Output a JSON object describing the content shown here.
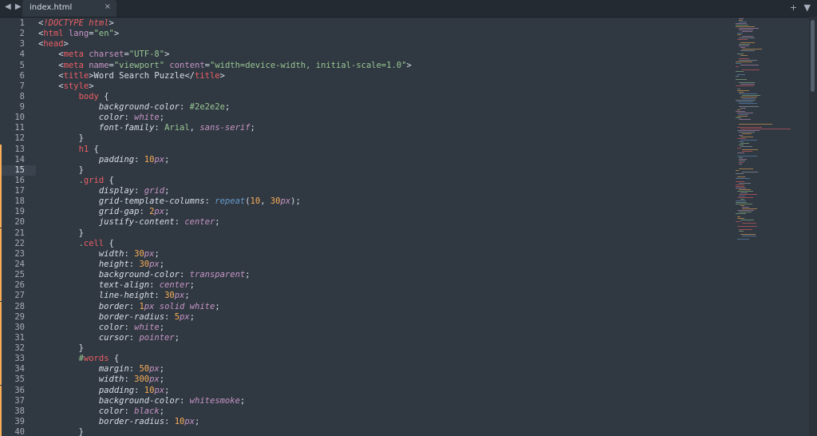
{
  "tabbar": {
    "nav_arrows": "◀ ▶",
    "tab_label": "index.html",
    "tab_close": "×",
    "right_controls": [
      "+",
      "▼"
    ]
  },
  "editor": {
    "active_line": 15,
    "modified_lines": [
      13,
      14,
      15,
      16,
      17,
      18,
      19,
      20,
      21,
      22,
      23,
      24,
      25,
      26,
      27,
      28,
      29,
      30,
      31,
      32,
      33,
      34,
      35,
      36,
      37,
      38,
      39,
      40
    ],
    "lines": [
      {
        "n": "1",
        "tokens": [
          [
            "punc",
            "<"
          ],
          [
            "bang",
            "!DOCTYPE"
          ],
          [
            "punc",
            " "
          ],
          [
            "bang",
            "html"
          ],
          [
            "punc",
            ">"
          ]
        ]
      },
      {
        "n": "2",
        "tokens": [
          [
            "punc",
            "<"
          ],
          [
            "tag",
            "html"
          ],
          [
            "punc",
            " "
          ],
          [
            "attr",
            "lang"
          ],
          [
            "punc",
            "="
          ],
          [
            "str",
            "\"en\""
          ],
          [
            "punc",
            ">"
          ]
        ]
      },
      {
        "n": "3",
        "tokens": [
          [
            "punc",
            "<"
          ],
          [
            "tag",
            "head"
          ],
          [
            "punc",
            ">"
          ]
        ]
      },
      {
        "n": "4",
        "tokens": [
          [
            "punc",
            "    <"
          ],
          [
            "tag",
            "meta"
          ],
          [
            "punc",
            " "
          ],
          [
            "attr",
            "charset"
          ],
          [
            "punc",
            "="
          ],
          [
            "str",
            "\"UTF-8\""
          ],
          [
            "punc",
            ">"
          ]
        ]
      },
      {
        "n": "5",
        "tokens": [
          [
            "punc",
            "    <"
          ],
          [
            "tag",
            "meta"
          ],
          [
            "punc",
            " "
          ],
          [
            "attr",
            "name"
          ],
          [
            "punc",
            "="
          ],
          [
            "str",
            "\"viewport\""
          ],
          [
            "punc",
            " "
          ],
          [
            "attr",
            "content"
          ],
          [
            "punc",
            "="
          ],
          [
            "str",
            "\"width=device-width, initial-scale=1.0\""
          ],
          [
            "punc",
            ">"
          ]
        ]
      },
      {
        "n": "6",
        "tokens": [
          [
            "punc",
            "    <"
          ],
          [
            "tag",
            "title"
          ],
          [
            "punc",
            ">Word Search Puzzle</"
          ],
          [
            "tag",
            "title"
          ],
          [
            "punc",
            ">"
          ]
        ]
      },
      {
        "n": "7",
        "tokens": [
          [
            "punc",
            "    <"
          ],
          [
            "tag",
            "style"
          ],
          [
            "punc",
            ">"
          ]
        ]
      },
      {
        "n": "8",
        "tokens": [
          [
            "punc",
            "        "
          ],
          [
            "sel",
            "body"
          ],
          [
            "punc",
            " {"
          ]
        ]
      },
      {
        "n": "9",
        "tokens": [
          [
            "punc",
            "            "
          ],
          [
            "prop",
            "background-color"
          ],
          [
            "punc",
            ": "
          ],
          [
            "hash",
            "#2e2e2e"
          ],
          [
            "punc",
            ";"
          ]
        ]
      },
      {
        "n": "10",
        "tokens": [
          [
            "punc",
            "            "
          ],
          [
            "prop",
            "color"
          ],
          [
            "punc",
            ": "
          ],
          [
            "val",
            "white"
          ],
          [
            "punc",
            ";"
          ]
        ]
      },
      {
        "n": "11",
        "tokens": [
          [
            "punc",
            "            "
          ],
          [
            "prop",
            "font-family"
          ],
          [
            "punc",
            ": "
          ],
          [
            "str",
            "Arial"
          ],
          [
            "punc",
            ", "
          ],
          [
            "val",
            "sans-serif"
          ],
          [
            "punc",
            ";"
          ]
        ]
      },
      {
        "n": "12",
        "tokens": [
          [
            "punc",
            "        }"
          ]
        ]
      },
      {
        "n": "13",
        "tokens": [
          [
            "punc",
            "        "
          ],
          [
            "sel",
            "h1"
          ],
          [
            "punc",
            " {"
          ]
        ]
      },
      {
        "n": "14",
        "tokens": [
          [
            "punc",
            "            "
          ],
          [
            "prop",
            "padding"
          ],
          [
            "punc",
            ": "
          ],
          [
            "num",
            "10"
          ],
          [
            "unit",
            "px"
          ],
          [
            "punc",
            ";"
          ]
        ]
      },
      {
        "n": "15",
        "tokens": [
          [
            "punc",
            "        }"
          ]
        ]
      },
      {
        "n": "16",
        "tokens": [
          [
            "punc",
            "        "
          ],
          [
            "hash",
            "."
          ],
          [
            "sel",
            "grid"
          ],
          [
            "punc",
            " {"
          ]
        ]
      },
      {
        "n": "17",
        "tokens": [
          [
            "punc",
            "            "
          ],
          [
            "prop",
            "display"
          ],
          [
            "punc",
            ": "
          ],
          [
            "val",
            "grid"
          ],
          [
            "punc",
            ";"
          ]
        ]
      },
      {
        "n": "18",
        "tokens": [
          [
            "punc",
            "            "
          ],
          [
            "prop",
            "grid-template-columns"
          ],
          [
            "punc",
            ": "
          ],
          [
            "fn",
            "repeat"
          ],
          [
            "punc",
            "("
          ],
          [
            "num",
            "10"
          ],
          [
            "punc",
            ", "
          ],
          [
            "num",
            "30"
          ],
          [
            "unit",
            "px"
          ],
          [
            "punc",
            ");"
          ]
        ]
      },
      {
        "n": "19",
        "tokens": [
          [
            "punc",
            "            "
          ],
          [
            "prop",
            "grid-gap"
          ],
          [
            "punc",
            ": "
          ],
          [
            "num",
            "2"
          ],
          [
            "unit",
            "px"
          ],
          [
            "punc",
            ";"
          ]
        ]
      },
      {
        "n": "20",
        "tokens": [
          [
            "punc",
            "            "
          ],
          [
            "prop",
            "justify-content"
          ],
          [
            "punc",
            ": "
          ],
          [
            "val",
            "center"
          ],
          [
            "punc",
            ";"
          ]
        ]
      },
      {
        "n": "21",
        "tokens": [
          [
            "punc",
            "        }"
          ]
        ]
      },
      {
        "n": "22",
        "tokens": [
          [
            "punc",
            "        "
          ],
          [
            "hash",
            "."
          ],
          [
            "sel",
            "cell"
          ],
          [
            "punc",
            " {"
          ]
        ]
      },
      {
        "n": "23",
        "tokens": [
          [
            "punc",
            "            "
          ],
          [
            "prop",
            "width"
          ],
          [
            "punc",
            ": "
          ],
          [
            "num",
            "30"
          ],
          [
            "unit",
            "px"
          ],
          [
            "punc",
            ";"
          ]
        ]
      },
      {
        "n": "24",
        "tokens": [
          [
            "punc",
            "            "
          ],
          [
            "prop",
            "height"
          ],
          [
            "punc",
            ": "
          ],
          [
            "num",
            "30"
          ],
          [
            "unit",
            "px"
          ],
          [
            "punc",
            ";"
          ]
        ]
      },
      {
        "n": "25",
        "tokens": [
          [
            "punc",
            "            "
          ],
          [
            "prop",
            "background-color"
          ],
          [
            "punc",
            ": "
          ],
          [
            "val",
            "transparent"
          ],
          [
            "punc",
            ";"
          ]
        ]
      },
      {
        "n": "26",
        "tokens": [
          [
            "punc",
            "            "
          ],
          [
            "prop",
            "text-align"
          ],
          [
            "punc",
            ": "
          ],
          [
            "val",
            "center"
          ],
          [
            "punc",
            ";"
          ]
        ]
      },
      {
        "n": "27",
        "tokens": [
          [
            "punc",
            "            "
          ],
          [
            "prop",
            "line-height"
          ],
          [
            "punc",
            ": "
          ],
          [
            "num",
            "30"
          ],
          [
            "unit",
            "px"
          ],
          [
            "punc",
            ";"
          ]
        ]
      },
      {
        "n": "28",
        "tokens": [
          [
            "punc",
            "            "
          ],
          [
            "prop",
            "border"
          ],
          [
            "punc",
            ": "
          ],
          [
            "num",
            "1"
          ],
          [
            "unit",
            "px"
          ],
          [
            "punc",
            " "
          ],
          [
            "val",
            "solid"
          ],
          [
            "punc",
            " "
          ],
          [
            "val",
            "white"
          ],
          [
            "punc",
            ";"
          ]
        ]
      },
      {
        "n": "29",
        "tokens": [
          [
            "punc",
            "            "
          ],
          [
            "prop",
            "border-radius"
          ],
          [
            "punc",
            ": "
          ],
          [
            "num",
            "5"
          ],
          [
            "unit",
            "px"
          ],
          [
            "punc",
            ";"
          ]
        ]
      },
      {
        "n": "30",
        "tokens": [
          [
            "punc",
            "            "
          ],
          [
            "prop",
            "color"
          ],
          [
            "punc",
            ": "
          ],
          [
            "val",
            "white"
          ],
          [
            "punc",
            ";"
          ]
        ]
      },
      {
        "n": "31",
        "tokens": [
          [
            "punc",
            "            "
          ],
          [
            "prop",
            "cursor"
          ],
          [
            "punc",
            ": "
          ],
          [
            "val",
            "pointer"
          ],
          [
            "punc",
            ";"
          ]
        ]
      },
      {
        "n": "32",
        "tokens": [
          [
            "punc",
            "        }"
          ]
        ]
      },
      {
        "n": "33",
        "tokens": [
          [
            "punc",
            "        "
          ],
          [
            "hash",
            "#"
          ],
          [
            "sel",
            "words"
          ],
          [
            "punc",
            " {"
          ]
        ]
      },
      {
        "n": "34",
        "tokens": [
          [
            "punc",
            "            "
          ],
          [
            "prop",
            "margin"
          ],
          [
            "punc",
            ": "
          ],
          [
            "num",
            "50"
          ],
          [
            "unit",
            "px"
          ],
          [
            "punc",
            ";"
          ]
        ]
      },
      {
        "n": "35",
        "tokens": [
          [
            "punc",
            "            "
          ],
          [
            "prop",
            "width"
          ],
          [
            "punc",
            ": "
          ],
          [
            "num",
            "300"
          ],
          [
            "unit",
            "px"
          ],
          [
            "punc",
            ";"
          ]
        ]
      },
      {
        "n": "36",
        "tokens": [
          [
            "punc",
            "            "
          ],
          [
            "prop",
            "padding"
          ],
          [
            "punc",
            ": "
          ],
          [
            "num",
            "10"
          ],
          [
            "unit",
            "px"
          ],
          [
            "punc",
            ";"
          ]
        ]
      },
      {
        "n": "37",
        "tokens": [
          [
            "punc",
            "            "
          ],
          [
            "prop",
            "background-color"
          ],
          [
            "punc",
            ": "
          ],
          [
            "val",
            "whitesmoke"
          ],
          [
            "punc",
            ";"
          ]
        ]
      },
      {
        "n": "38",
        "tokens": [
          [
            "punc",
            "            "
          ],
          [
            "prop",
            "color"
          ],
          [
            "punc",
            ": "
          ],
          [
            "val",
            "black"
          ],
          [
            "punc",
            ";"
          ]
        ]
      },
      {
        "n": "39",
        "tokens": [
          [
            "punc",
            "            "
          ],
          [
            "prop",
            "border-radius"
          ],
          [
            "punc",
            ": "
          ],
          [
            "num",
            "10"
          ],
          [
            "unit",
            "px"
          ],
          [
            "punc",
            ";"
          ]
        ]
      },
      {
        "n": "40",
        "tokens": [
          [
            "punc",
            "        }"
          ]
        ]
      }
    ]
  },
  "colors": {
    "background": "#303841",
    "tabbar": "#232a31",
    "modified_marker": "#f9ae58",
    "tag": "#ec5f66",
    "attribute": "#c695c6",
    "string": "#99c794",
    "number": "#f9ae58",
    "function": "#6699cc",
    "text": "#d8dee9"
  }
}
